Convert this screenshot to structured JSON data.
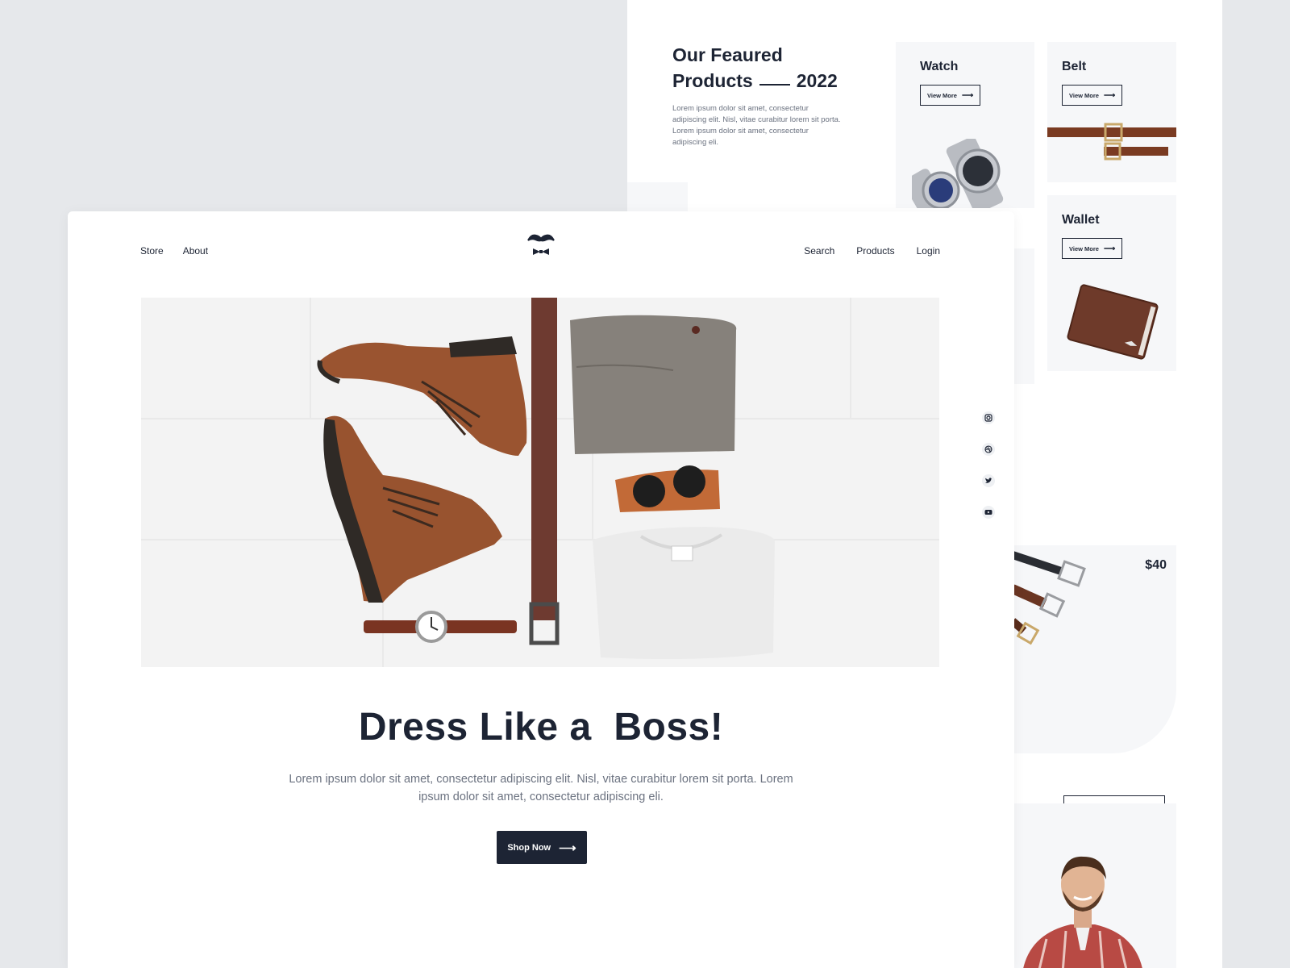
{
  "featured": {
    "title_line1": "Our Feaured",
    "title_line2": "Products",
    "year": "2022",
    "description": "Lorem ipsum dolor sit amet, consectetur adipiscing elit. Nisl, vitae curabitur lorem sit porta. Lorem ipsum dolor sit amet, consectetur adipiscing eli.",
    "cards": [
      {
        "name": "Watch",
        "button": "View More"
      },
      {
        "name": "Belt",
        "button": "View More"
      },
      {
        "name": "Wallet",
        "button": "View More"
      }
    ],
    "price": "$40"
  },
  "nav": {
    "left": [
      "Store",
      "About"
    ],
    "right": [
      "Search",
      "Products",
      "Login"
    ]
  },
  "hero": {
    "title": "Dress Like a  Boss!",
    "description": "Lorem ipsum dolor sit amet, consectetur adipiscing elit. Nisl, vitae curabitur lorem sit porta. Lorem ipsum dolor sit amet, consectetur adipiscing eli.",
    "cta": "Shop Now"
  },
  "socials": [
    "instagram-icon",
    "dribbble-icon",
    "twitter-icon",
    "youtube-icon"
  ],
  "colors": {
    "dark": "#1d2434",
    "muted_text": "#6b7280",
    "card_bg": "#f6f7f9",
    "page_bg": "#e6e8eb",
    "leather": "#8a4a2a"
  }
}
